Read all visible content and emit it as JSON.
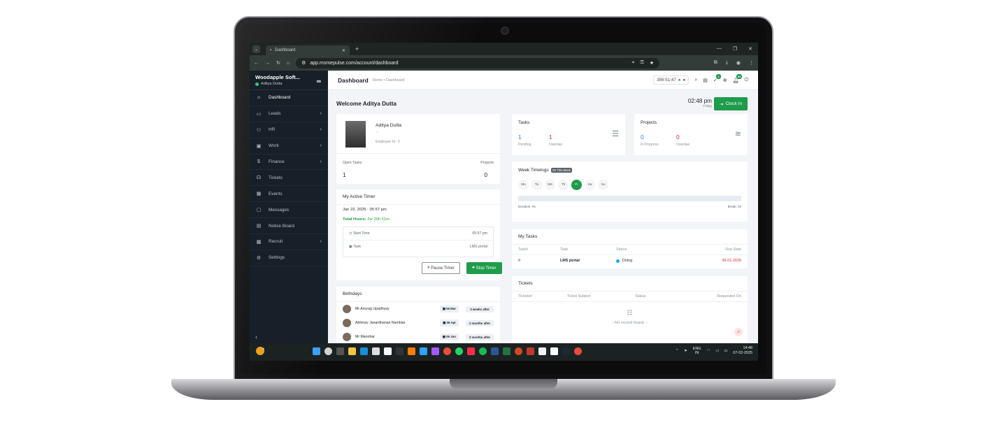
{
  "browser": {
    "tab_title": "Dashboard",
    "url": "app.msmepulse.com/account/dashboard"
  },
  "sidebar": {
    "company": "Woodapple Soft...",
    "user": "Aditya Dutta",
    "items": [
      {
        "label": "Dashboard",
        "icon": "home-icon",
        "chevron": false
      },
      {
        "label": "Leads",
        "icon": "leads-icon",
        "chevron": true
      },
      {
        "label": "HR",
        "icon": "users-icon",
        "chevron": true
      },
      {
        "label": "Work",
        "icon": "briefcase-icon",
        "chevron": true
      },
      {
        "label": "Finance",
        "icon": "dollar-icon",
        "chevron": true
      },
      {
        "label": "Tickets",
        "icon": "headset-icon",
        "chevron": false
      },
      {
        "label": "Events",
        "icon": "calendar-icon",
        "chevron": false
      },
      {
        "label": "Messages",
        "icon": "message-icon",
        "chevron": false
      },
      {
        "label": "Notice Board",
        "icon": "notice-icon",
        "chevron": false
      },
      {
        "label": "Recruit",
        "icon": "recruit-icon",
        "chevron": true
      },
      {
        "label": "Settings",
        "icon": "gear-icon",
        "chevron": false
      }
    ]
  },
  "topbar": {
    "title": "Dashboard",
    "breadcrumb": "Home • Dashboard",
    "timer": "356:51:47",
    "badge_tasks": "1",
    "badge_notifications": "34"
  },
  "welcome": {
    "text": "Welcome Aditya Dutta",
    "time": "02:48 pm",
    "day": "Friday",
    "clock_in": "Clock In"
  },
  "profile": {
    "name": "Aditya Dutta",
    "sub": "--",
    "employee_id": "Employee Id : 5",
    "open_tasks_label": "Open Tasks",
    "open_tasks": "1",
    "projects_label": "Projects",
    "projects": "0"
  },
  "timer_card": {
    "title": "My Active Timer",
    "start": "Jan 23, 2025 - 05:57 pm",
    "total_label": "Total Hours:",
    "total_value": "2w 20h 51m",
    "start_time_label": "Start Time",
    "start_time_value": "05:57 pm",
    "task_label": "Task",
    "task_value": "LMS portal",
    "pause": "Pause Timer",
    "stop": "Stop Timer"
  },
  "birthdays": {
    "title": "Birthdays",
    "items": [
      {
        "name": "Mr Anurag Upadhyay",
        "date": "06 Mar",
        "when": "3 weeks after"
      },
      {
        "name": "Abhinav Janardhanan Nambiar",
        "date": "06 Apr",
        "when": "2 months after"
      },
      {
        "name": "Mr Manohar",
        "date": "06 Jun",
        "when": "3 months after"
      }
    ]
  },
  "tasks_card": {
    "title": "Tasks",
    "pending": "1",
    "pending_label": "Pending",
    "overdue": "1",
    "overdue_label": "Overdue"
  },
  "projects_card": {
    "title": "Projects",
    "in_progress": "0",
    "in_progress_label": "In Progress",
    "overdue": "0",
    "overdue_label": "Overdue"
  },
  "timelogs": {
    "title": "Week Timelogs",
    "tag": "On This Week",
    "days": [
      "Mo",
      "Tu",
      "We",
      "Th",
      "Fr",
      "Sa",
      "Su"
    ],
    "duration": "Duration: 0s",
    "break": "Break: 0s"
  },
  "my_tasks": {
    "title": "My Tasks",
    "headers": [
      "Task#",
      "Task",
      "Status",
      "Due Date"
    ],
    "row": {
      "num": "#",
      "task": "LMS portal",
      "status": "Doing",
      "due": "30-01-2025"
    }
  },
  "tickets": {
    "title": "Tickets",
    "headers": [
      "Tickets#",
      "Ticket Subject",
      "Status",
      "Requested On"
    ],
    "empty": "- No record found. -"
  },
  "taskbar": {
    "lang": "ENG",
    "region": "IN",
    "time": "14:48",
    "date": "07-02-2025",
    "notif": "1"
  },
  "colors": {
    "accent": "#1e9c4a",
    "sidebar": "#171f29",
    "danger": "#d2232a",
    "info": "#1f7fd6"
  }
}
